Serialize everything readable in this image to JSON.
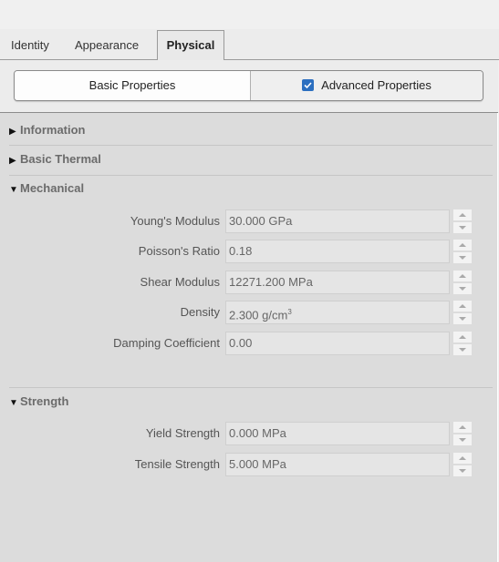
{
  "tabs": [
    {
      "label": "Identity",
      "selected": false
    },
    {
      "label": "Appearance",
      "selected": false
    },
    {
      "label": "Physical",
      "selected": true
    }
  ],
  "mode_toggle": {
    "basic_label": "Basic Properties",
    "advanced_label": "Advanced Properties",
    "advanced_checked": true
  },
  "sections": {
    "information": {
      "label": "Information",
      "expanded": false
    },
    "basic_thermal": {
      "label": "Basic Thermal",
      "expanded": false
    },
    "mechanical": {
      "label": "Mechanical",
      "expanded": true,
      "fields": [
        {
          "label": "Young's Modulus",
          "value": "30.000 GPa"
        },
        {
          "label": "Poisson's Ratio",
          "value": "0.18"
        },
        {
          "label": "Shear Modulus",
          "value": "12271.200 MPa"
        },
        {
          "label": "Density",
          "value": "2.300 g/cm",
          "unit_sup": "3"
        },
        {
          "label": "Damping Coefficient",
          "value": "0.00"
        }
      ]
    },
    "strength": {
      "label": "Strength",
      "expanded": true,
      "fields": [
        {
          "label": "Yield Strength",
          "value": "0.000 MPa"
        },
        {
          "label": "Tensile Strength",
          "value": "5.000 MPa"
        }
      ]
    }
  },
  "icons": {
    "collapsed": "▶",
    "expanded": "▼"
  },
  "colors": {
    "checkbox_accent": "#2c6fc0",
    "panel_bg": "#dcdcdc",
    "section_header_text": "#6b6b6b"
  }
}
